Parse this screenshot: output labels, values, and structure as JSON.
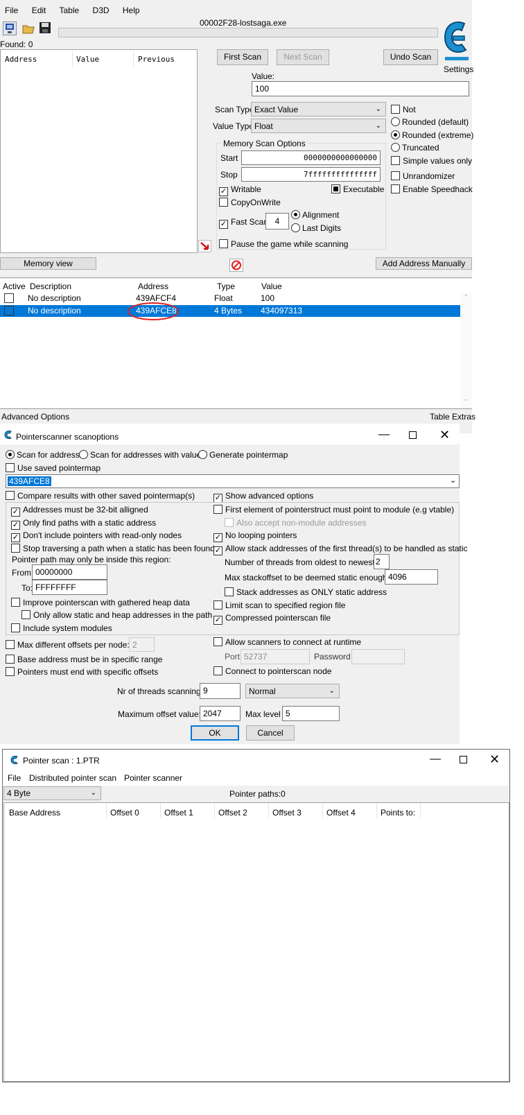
{
  "ce": {
    "menu": [
      "File",
      "Edit",
      "Table",
      "D3D",
      "Help"
    ],
    "process_title": "00002F28-lostsaga.exe",
    "found": "Found: 0",
    "results_columns": [
      "Address",
      "Value",
      "Previous"
    ],
    "first_scan": "First Scan",
    "next_scan": "Next Scan",
    "undo_scan": "Undo Scan",
    "settings": "Settings",
    "value_label": "Value:",
    "value": "100",
    "scan_type_label": "Scan Type",
    "scan_type": "Exact Value",
    "value_type_label": "Value Type",
    "value_type": "Float",
    "opt_not": "Not",
    "opt_rounded_default": "Rounded (default)",
    "opt_rounded_extreme": "Rounded (extreme)",
    "opt_truncated": "Truncated",
    "opt_simple_values": "Simple values only",
    "opt_unrandomizer": "Unrandomizer",
    "opt_speedhack": "Enable Speedhack",
    "mem_group": "Memory Scan Options",
    "start_label": "Start",
    "start_value": "0000000000000000",
    "stop_label": "Stop",
    "stop_value": "7fffffffffffffff",
    "writable": "Writable",
    "executable": "Executable",
    "copyonwrite": "CopyOnWrite",
    "fast_scan": "Fast Scan",
    "fast_scan_value": "4",
    "alignment": "Alignment",
    "last_digits": "Last Digits",
    "pause_game": "Pause the game while scanning",
    "memory_view": "Memory view",
    "add_address": "Add Address Manually",
    "table_columns": [
      "Active",
      "Description",
      "Address",
      "Type",
      "Value"
    ],
    "table_rows": [
      {
        "description": "No description",
        "address": "439AFCF4",
        "type": "Float",
        "value": "100"
      },
      {
        "description": "No description",
        "address": "439AFCE8",
        "type": "4 Bytes",
        "value": "434097313"
      }
    ],
    "advanced_options": "Advanced Options",
    "table_extras": "Table Extras",
    "highlight_color": "#0078d7",
    "circle_color": "#e02020"
  },
  "ps": {
    "title": "Pointerscanner scanoptions",
    "scan_for_address": "Scan for address",
    "scan_for_value": "Scan for addresses with value",
    "generate_pointermap": "Generate pointermap",
    "use_saved": "Use saved pointermap",
    "address_value": "439AFCE8",
    "compare_results": "Compare results with other saved pointermap(s)",
    "show_advanced": "Show advanced options",
    "addr_32bit": "Addresses must be 32-bit alligned",
    "static_paths": "Only find paths with a static address",
    "no_readonly": "Don't include pointers with read-only nodes",
    "stop_traversing": "Stop traversing a path when a static has been found",
    "region_label": "Pointer path may only be inside this region:",
    "from_label": "From",
    "from_value": "00000000",
    "to_label": "To:",
    "to_value": "FFFFFFFF",
    "improve_heap": "Improve pointerscan with gathered heap data",
    "only_static_heap": "Only allow static and heap addresses in the path",
    "include_system": "Include system modules",
    "first_element": "First element of pointerstruct must point to module (e.g vtable)",
    "non_module": "Also accept non-module addresses",
    "no_looping": "No looping pointers",
    "allow_stack": "Allow stack addresses of the first thread(s) to be handled as static",
    "threads_oldest": "Number of threads from oldest to newest:",
    "threads_oldest_value": "2",
    "max_stackoffset": "Max stackoffset to be deemed static enough:",
    "max_stackoffset_value": "4096",
    "stack_only_static": "Stack addresses as ONLY static address",
    "limit_region": "Limit scan to specified region file",
    "compressed": "Compressed pointerscan file",
    "max_diff_offsets": "Max different offsets per node:",
    "max_diff_offsets_value": "2",
    "base_range": "Base address must be in specific range",
    "end_offsets": "Pointers must end with specific offsets",
    "allow_runtime": "Allow scanners to connect at runtime",
    "port_label": "Port:",
    "port_value": "52737",
    "password_label": "Password",
    "connect_node": "Connect to pointerscan node",
    "nr_threads_label": "Nr of threads scanning:",
    "nr_threads_value": "9",
    "priority": "Normal",
    "max_offset_label": "Maximum offset value:",
    "max_offset_value": "2047",
    "max_level_label": "Max level",
    "max_level_value": "5",
    "ok": "OK",
    "cancel": "Cancel"
  },
  "pr": {
    "title": "Pointer scan : 1.PTR",
    "menu": [
      "File",
      "Distributed pointer scan",
      "Pointer scanner"
    ],
    "type": "4 Byte",
    "pointer_paths": "Pointer paths:0",
    "columns": [
      "Base Address",
      "Offset 0",
      "Offset 1",
      "Offset 2",
      "Offset 3",
      "Offset 4",
      "Points to:"
    ]
  }
}
